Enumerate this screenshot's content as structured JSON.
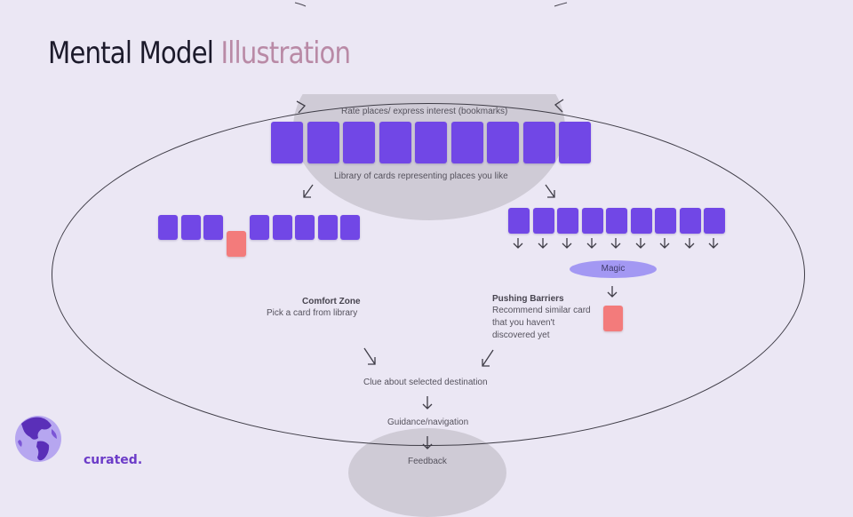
{
  "title": {
    "main": "Mental Model",
    "accent": "Illustration"
  },
  "top": {
    "label": "Rate places/ express interest (bookmarks)",
    "library_label": "Library of cards representing places you like",
    "card_count": 9
  },
  "left_branch": {
    "cards_before": 3,
    "cards_after": 5
  },
  "right_branch": {
    "card_count": 9,
    "magic_label": "Magic"
  },
  "comfort_zone": {
    "heading": "Comfort Zone",
    "text": "Pick a card from library"
  },
  "pushing_barriers": {
    "heading": "Pushing Barriers",
    "lines": [
      "Recommend similar card",
      "that you haven't",
      "discovered yet"
    ]
  },
  "flow": {
    "clue": "Clue about selected destination",
    "guidance": "Guidance/navigation",
    "feedback": "Feedback"
  },
  "brand": {
    "name": "curated."
  },
  "colors": {
    "card": "#7147e6",
    "highlight_card": "#f37b7b",
    "magic": "#a398f3",
    "accent": "#b98aa6"
  }
}
